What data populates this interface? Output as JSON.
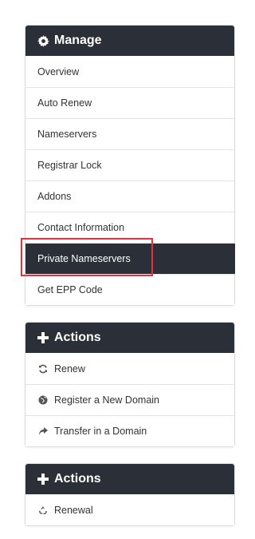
{
  "manage": {
    "title": "Manage",
    "items": [
      {
        "label": "Overview"
      },
      {
        "label": "Auto Renew"
      },
      {
        "label": "Nameservers"
      },
      {
        "label": "Registrar Lock"
      },
      {
        "label": "Addons"
      },
      {
        "label": "Contact Information"
      },
      {
        "label": "Private Nameservers",
        "active": true
      },
      {
        "label": "Get EPP Code"
      }
    ]
  },
  "actions": {
    "title": "Actions",
    "items": [
      {
        "label": "Renew",
        "icon": "refresh-icon"
      },
      {
        "label": "Register a New Domain",
        "icon": "globe-icon"
      },
      {
        "label": "Transfer in a Domain",
        "icon": "share-arrow-icon"
      }
    ]
  },
  "actions2": {
    "title": "Actions",
    "items": [
      {
        "label": "Renewal",
        "icon": "recycle-icon"
      }
    ]
  },
  "colors": {
    "header_bg": "#2b2f38",
    "active_bg": "#2b2f38",
    "highlight": "#e8323a"
  }
}
